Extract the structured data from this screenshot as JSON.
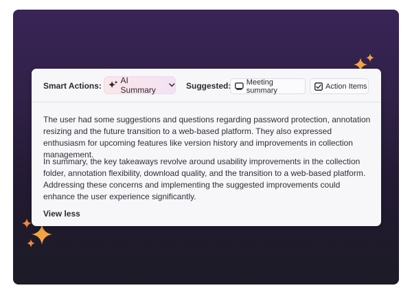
{
  "toolbar": {
    "smart_actions_label": "Smart Actions:",
    "ai_summary_label": "AI Summary",
    "suggested_label": "Suggested:",
    "meeting_summary_label": "Meeting summary",
    "action_items_label": "Action Items"
  },
  "content": {
    "paragraph_1": "The user had some suggestions and questions regarding password protection, annotation resizing and the future transition to a web-based platform. They also expressed enthusiasm for upcoming features like version history and improvements in collection management.",
    "paragraph_2": "In summary, the key takeaways revolve around usability improvements in the collection folder, annotation flexibility, download quality, and the transition to a web-based platform. Addressing these concerns and implementing the suggested improvements could enhance the user experience significantly.",
    "view_less_label": "View less"
  },
  "icons": {
    "ai_summary": "sparkles-icon",
    "dropdown": "chevron-down-icon",
    "meeting_summary": "monitor-icon",
    "action_items": "checkbox-icon",
    "decoration": "sparkle-icon"
  },
  "colors": {
    "background_top": "#3a2457",
    "background_bottom": "#1c1b26",
    "card": "#f7f7fa",
    "sparkle": "#f2a441",
    "ai_button_gradient_start": "#fbe6e6",
    "ai_button_gradient_end": "#f3e2f4"
  }
}
